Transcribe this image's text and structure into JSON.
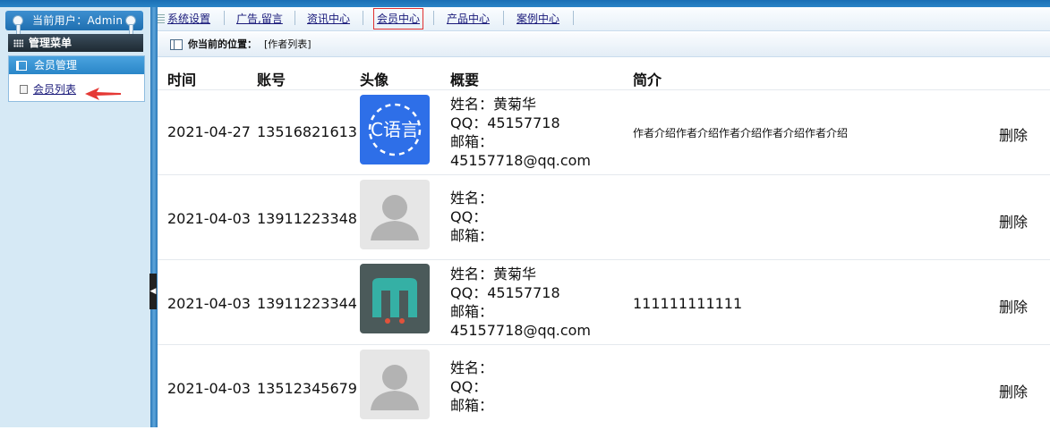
{
  "sidebar": {
    "current_user": "当前用户：Admin",
    "menu_title": "管理菜单",
    "group_title": "会员管理",
    "items": [
      {
        "label": "会员列表"
      }
    ]
  },
  "nav": {
    "items": [
      {
        "label": "系统设置"
      },
      {
        "label": "广告,留言"
      },
      {
        "label": "资讯中心"
      },
      {
        "label": "会员中心"
      },
      {
        "label": "产品中心"
      },
      {
        "label": "案例中心"
      }
    ]
  },
  "breadcrumb": {
    "label": "你当前的位置：",
    "value": "[作者列表]"
  },
  "table": {
    "headers": {
      "time": "时间",
      "account": "账号",
      "avatar": "头像",
      "summary": "概要",
      "intro": "简介"
    },
    "rows": [
      {
        "time": "2021-04-27",
        "account": "13516821613",
        "avatar": "c-lang-logo",
        "avatar_text": "C语言",
        "summary": [
          "姓名：黄菊华",
          "QQ：45157718",
          "邮箱：",
          "45157718@qq.com"
        ],
        "intro": "作者介绍作者介绍作者介绍作者介绍作者介绍",
        "action": "删除"
      },
      {
        "time": "2021-04-03",
        "account": "13911223348",
        "avatar": "default-person",
        "summary": [
          "姓名：",
          "QQ：",
          "邮箱："
        ],
        "intro": "",
        "action": "删除"
      },
      {
        "time": "2021-04-03",
        "account": "13911223344",
        "avatar": "meituan-m-logo",
        "summary": [
          "姓名：黄菊华",
          "QQ：45157718",
          "邮箱：",
          "45157718@qq.com"
        ],
        "intro": "111111111111",
        "action": "删除"
      },
      {
        "time": "2021-04-03",
        "account": "13512345679",
        "avatar": "default-person",
        "summary": [
          "姓名：",
          "QQ：",
          "邮箱："
        ],
        "intro": "",
        "action": "删除"
      }
    ]
  },
  "colors": {
    "accent": "#2a86c8",
    "link": "#1a1a7a",
    "active_outline": "#e03030",
    "arrow": "#e53935"
  }
}
